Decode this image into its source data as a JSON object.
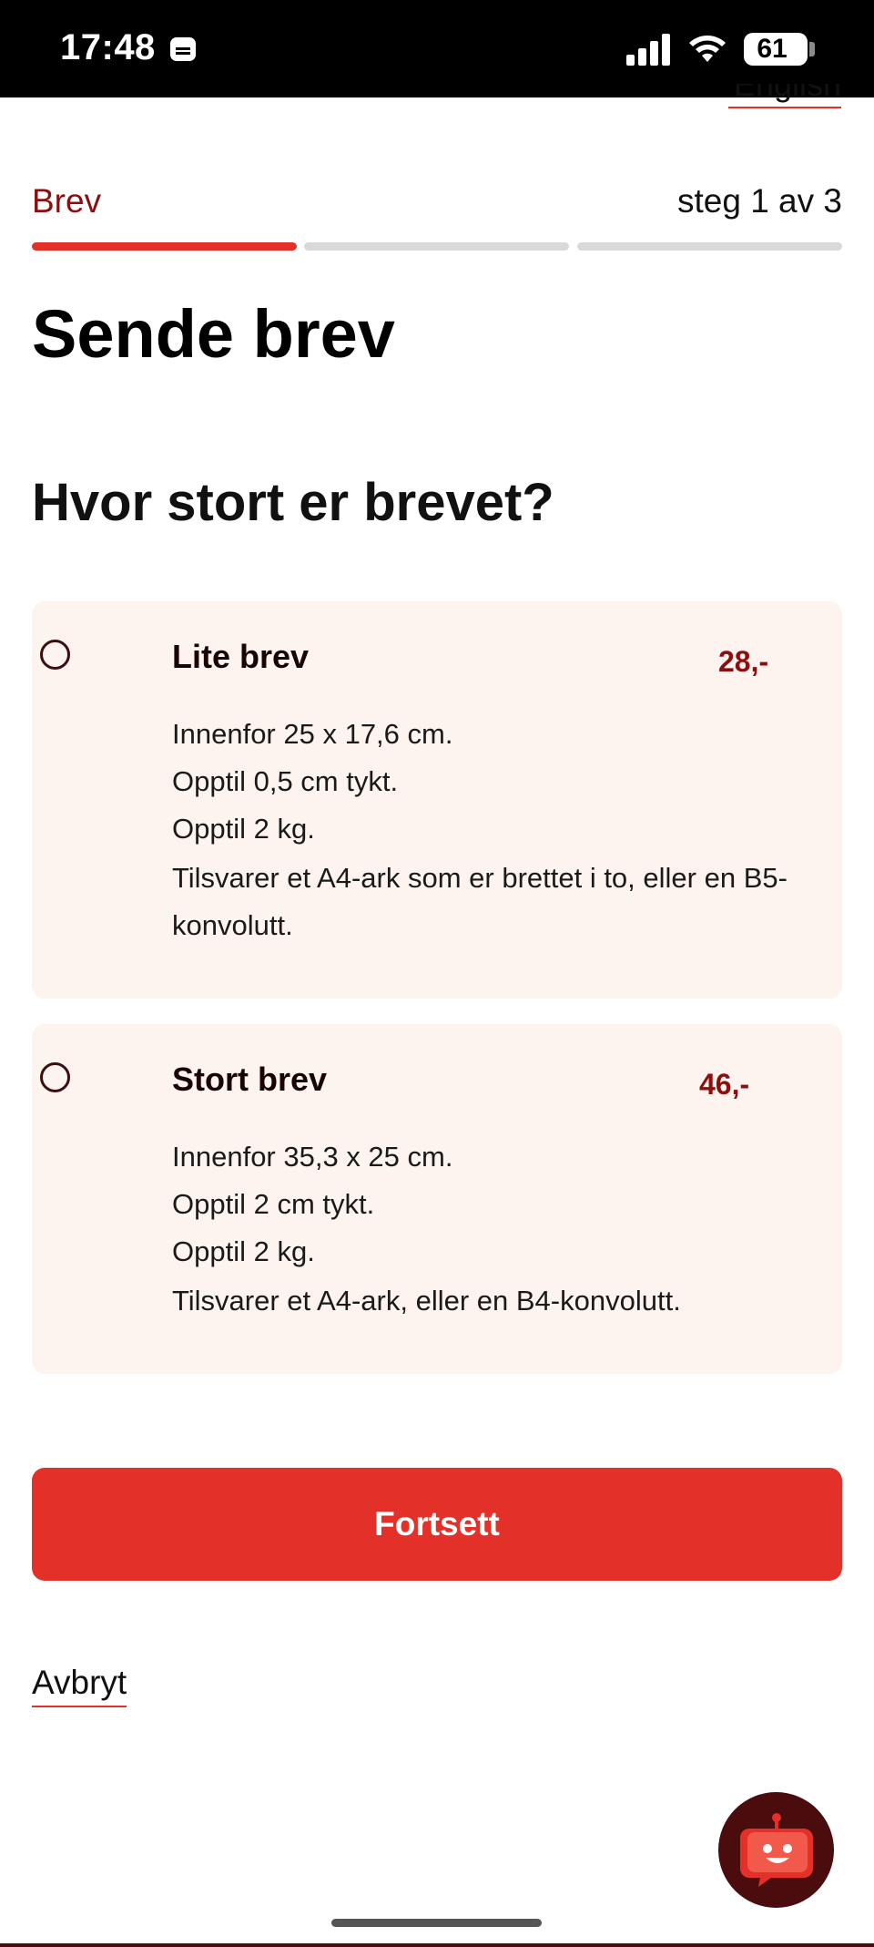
{
  "status_bar": {
    "time": "17:48",
    "battery": "61",
    "icons": [
      "sim-card-icon",
      "cellular-signal-icon",
      "wifi-icon",
      "battery-icon"
    ]
  },
  "header": {
    "language_link": "English"
  },
  "steps": {
    "label": "Brev",
    "count": "steg 1 av 3",
    "current": 1,
    "total": 3
  },
  "page": {
    "title": "Sende brev",
    "question": "Hvor stort er brevet?"
  },
  "options": [
    {
      "title": "Lite brev",
      "price": "28,-",
      "lines": [
        "Innenfor 25 x 17,6 cm.",
        "Opptil 0,5 cm tykt.",
        "Opptil 2 kg."
      ],
      "note": "Tilsvarer et A4-ark som er brettet i to, eller en B5-konvolutt.",
      "selected": false
    },
    {
      "title": "Stort brev",
      "price": "46,-",
      "lines": [
        "Innenfor 35,3 x 25 cm.",
        "Opptil 2 cm tykt.",
        "Opptil 2 kg."
      ],
      "note": "Tilsvarer et A4-ark, eller en B4-konvolutt.",
      "selected": false
    }
  ],
  "actions": {
    "continue_label": "Fortsett",
    "cancel_label": "Avbryt"
  },
  "chat": {
    "icon": "chatbot-icon"
  },
  "colors": {
    "accent": "#e3312a",
    "dark_red": "#8b0f0f",
    "card_bg": "#fdf3ef",
    "progress_inactive": "#d9d9d9"
  }
}
